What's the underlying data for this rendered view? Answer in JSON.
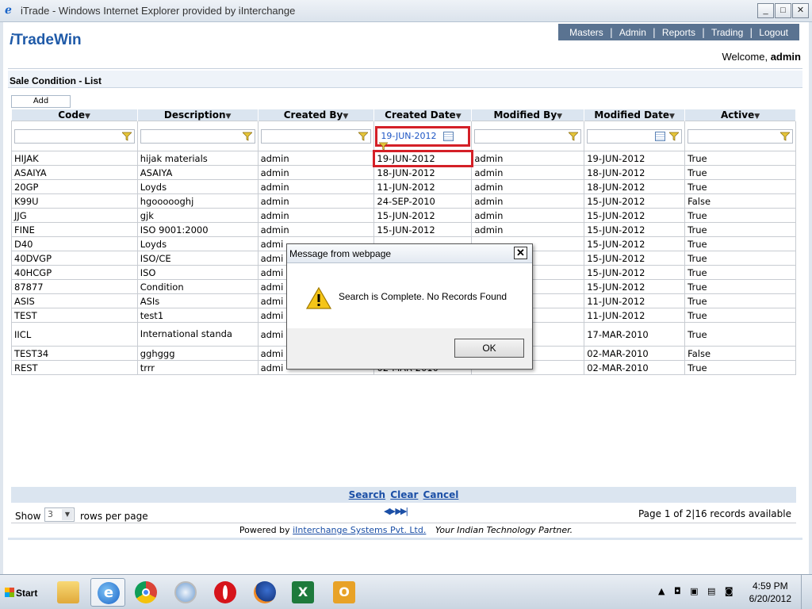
{
  "window": {
    "title": "iTrade - Windows Internet Explorer provided by iInterchange",
    "min": "_",
    "max": "□",
    "close": "✕"
  },
  "header": {
    "logo_i": "i",
    "logo_trade": "Trade",
    "logo_win": "Win",
    "nav": [
      "Masters",
      "Admin",
      "Reports",
      "Trading",
      "Logout"
    ],
    "welcome_prefix": "Welcome,",
    "welcome_user": "admin"
  },
  "page": {
    "title": "Sale Condition - List",
    "add_label": "Add"
  },
  "grid": {
    "columns": [
      "Code",
      "Description",
      "Created By",
      "Created Date",
      "Modified By",
      "Modified Date",
      "Active"
    ],
    "filters": {
      "created_date": "19-JUN-2012"
    },
    "rows": [
      [
        "HIJAK",
        "hijak materials",
        "admin",
        "19-JUN-2012",
        "admin",
        "19-JUN-2012",
        "True"
      ],
      [
        "ASAIYA",
        "ASAIYA",
        "admin",
        "18-JUN-2012",
        "admin",
        "18-JUN-2012",
        "True"
      ],
      [
        "20GP",
        "Loyds",
        "admin",
        "11-JUN-2012",
        "admin",
        "18-JUN-2012",
        "True"
      ],
      [
        "K99U",
        "hgoooooghj",
        "admin",
        "24-SEP-2010",
        "admin",
        "15-JUN-2012",
        "False"
      ],
      [
        "JJG",
        "gjk",
        "admin",
        "15-JUN-2012",
        "admin",
        "15-JUN-2012",
        "True"
      ],
      [
        "FINE",
        "ISO 9001:2000",
        "admin",
        "15-JUN-2012",
        "admin",
        "15-JUN-2012",
        "True"
      ],
      [
        "D40",
        "Loyds",
        "admi",
        "",
        "",
        "15-JUN-2012",
        "True"
      ],
      [
        "40DVGP",
        "ISO/CE",
        "admi",
        "",
        "",
        "15-JUN-2012",
        "True"
      ],
      [
        "40HCGP",
        "ISO",
        "admi",
        "",
        "",
        "15-JUN-2012",
        "True"
      ],
      [
        "87877",
        "Condition",
        "admi",
        "",
        "",
        "15-JUN-2012",
        "True"
      ],
      [
        "ASIS",
        "ASIs",
        "admi",
        "",
        "",
        "11-JUN-2012",
        "True"
      ],
      [
        "TEST",
        "test1",
        "admi",
        "",
        "",
        "11-JUN-2012",
        "True"
      ],
      [
        "IICL",
        "International standa",
        "admi",
        "",
        "",
        "17-MAR-2010",
        "True"
      ],
      [
        "TEST34",
        "gghggg",
        "admi",
        "",
        "",
        "02-MAR-2010",
        "False"
      ],
      [
        "REST",
        "trrr",
        "admi",
        "02-MAR-2010",
        "",
        "02-MAR-2010",
        "True"
      ]
    ]
  },
  "pager": {
    "search": "Search",
    "clear": "Clear",
    "cancel": "Cancel",
    "show": "Show",
    "rows_value": "3",
    "rows_per_page": "rows per page",
    "info": "Page 1 of 2|16 records available"
  },
  "footer": {
    "powered_by": "Powered by",
    "company": "iInterchange Systems Pvt. Ltd.",
    "tagline": "Your Indian Technology Partner."
  },
  "dialog": {
    "title": "Message from webpage",
    "message": "Search is Complete. No Records Found",
    "ok": "OK"
  },
  "taskbar": {
    "start": "Start",
    "time": "4:59 PM",
    "date": "6/20/2012"
  },
  "colors": {
    "nav_bg": "#5a7391",
    "header_bg": "#dbe5f0",
    "highlight": "#d42027",
    "link": "#1b4fa6"
  }
}
